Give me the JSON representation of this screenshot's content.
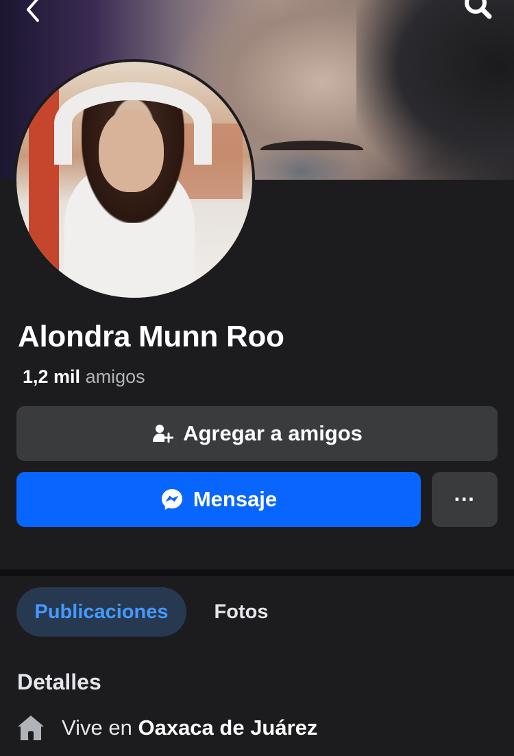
{
  "profile": {
    "name": "Alondra Munn Roo",
    "friends_count": "1,2 mil",
    "friends_label": "amigos"
  },
  "actions": {
    "add_friend_label": "Agregar a amigos",
    "message_label": "Mensaje",
    "more_label": "···"
  },
  "tabs": [
    {
      "label": "Publicaciones",
      "active": true
    },
    {
      "label": "Fotos",
      "active": false
    }
  ],
  "details": {
    "title": "Detalles",
    "lives_prefix": "Vive en",
    "lives_place": "Oaxaca de Juárez"
  },
  "icons": {
    "back": "chevron-left-icon",
    "search": "search-icon",
    "add_friend": "person-plus-icon",
    "messenger": "messenger-icon",
    "home": "home-icon"
  },
  "colors": {
    "background": "#1c1c1e",
    "primary": "#0866ff",
    "secondary_button": "#3a3b3d",
    "active_tab_bg": "#263951",
    "active_tab_text": "#4599ff"
  }
}
